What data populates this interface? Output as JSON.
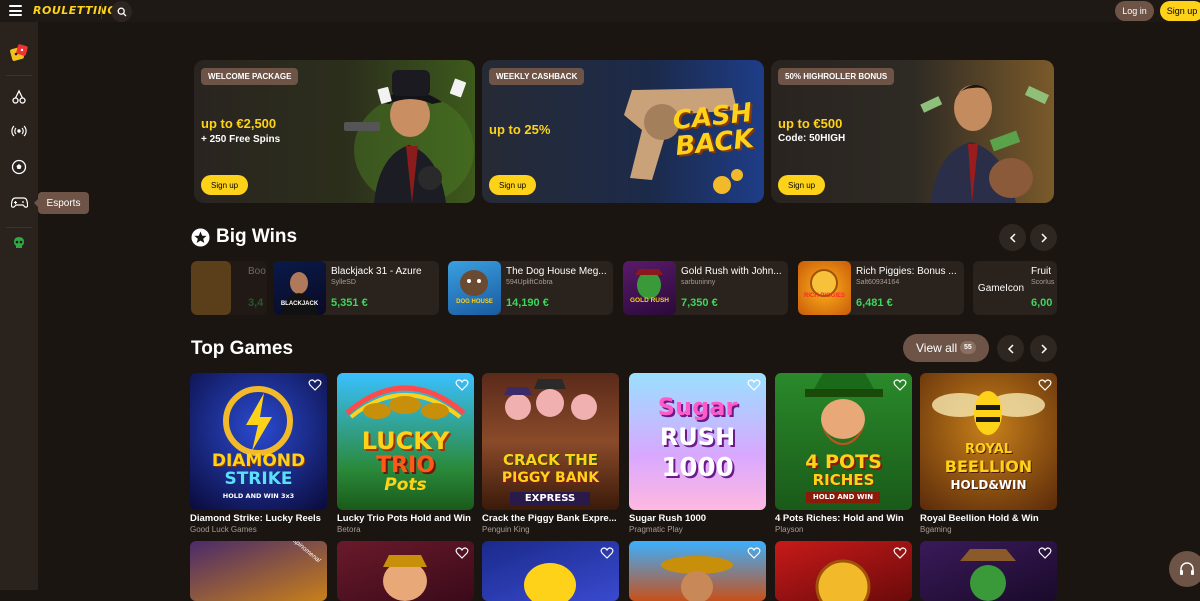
{
  "brand": {
    "logo_text": "ROULETTINO",
    "accent": "#ffd21a",
    "win_green": "#3dd65c"
  },
  "header": {
    "login_label": "Log in",
    "signup_label": "Sign up"
  },
  "sidebar": {
    "items": [
      {
        "name": "casino-icon"
      },
      {
        "name": "cherry-icon"
      },
      {
        "name": "live-icon"
      },
      {
        "name": "soccer-icon"
      },
      {
        "name": "gamepad-icon"
      },
      {
        "name": "skull-icon"
      }
    ],
    "tooltip": "Esports"
  },
  "promos": [
    {
      "tag": "WELCOME PACKAGE",
      "line1": "up to €2,500",
      "line2": "+ 250 Free Spins",
      "button": "Sign up"
    },
    {
      "tag": "WEEKLY CASHBACK",
      "line1": "up to 25%",
      "line2": "",
      "button": "Sign up",
      "art_text1": "CASH",
      "art_text2": "BACK"
    },
    {
      "tag": "50% HIGHROLLER BONUS",
      "line1": "up to €500",
      "line2": "Code: 50HIGH",
      "button": "Sign up"
    }
  ],
  "big_wins": {
    "title": "Big Wins",
    "items": [
      {
        "game": "Blackjack 31 - Azure",
        "user": "SylleSD",
        "amount": "5,351 €",
        "thumb_label": "BLACKJACK"
      },
      {
        "game": "The Dog House Meg...",
        "user": "594UpliftCobra",
        "amount": "14,190 €",
        "thumb_label": "DOG HOUSE"
      },
      {
        "game": "Gold Rush with John...",
        "user": "sarbuninny",
        "amount": "7,350 €",
        "thumb_label": "GOLD RUSH"
      },
      {
        "game": "Rich Piggies: Bonus ...",
        "user": "Salt60934164",
        "amount": "6,481 €",
        "thumb_label": "RICH PIGGIES"
      },
      {
        "game": "Fruit",
        "user": "Scorlus",
        "amount": "6,00",
        "thumb_label": "GameIcon"
      }
    ],
    "faded_left": {
      "game": "Boo",
      "amount": "3,4"
    }
  },
  "top_games": {
    "title": "Top Games",
    "view_all_label": "View all",
    "view_all_count": "55",
    "items": [
      {
        "title": "Diamond Strike: Lucky Reels",
        "provider": "Good Luck Games",
        "art1": "DIAMOND",
        "art2": "STRIKE",
        "art3": "HOLD AND WIN 3x3"
      },
      {
        "title": "Lucky Trio Pots Hold and Win",
        "provider": "Betora",
        "art1": "LUCKY",
        "art2": "TRIO",
        "art3": "Pots"
      },
      {
        "title": "Crack the Piggy Bank Expre...",
        "provider": "Penguin King",
        "art1": "CRACK THE",
        "art2": "PIGGY BANK",
        "art3": "EXPRESS"
      },
      {
        "title": "Sugar Rush 1000",
        "provider": "Pragmatic Play",
        "art1": "Sugar",
        "art2": "RUSH",
        "art3": "1000"
      },
      {
        "title": "4 Pots Riches: Hold and Win",
        "provider": "Playson",
        "art1": "4 POTS",
        "art2": "RICHES",
        "art3": "HOLD AND WIN"
      },
      {
        "title": "Royal Beellion Hold & Win",
        "provider": "Bgaming",
        "art1": "ROYAL",
        "art2": "BEELLION",
        "art3": "HOLD&WIN"
      }
    ],
    "row2_badge": "Spinomenal"
  }
}
